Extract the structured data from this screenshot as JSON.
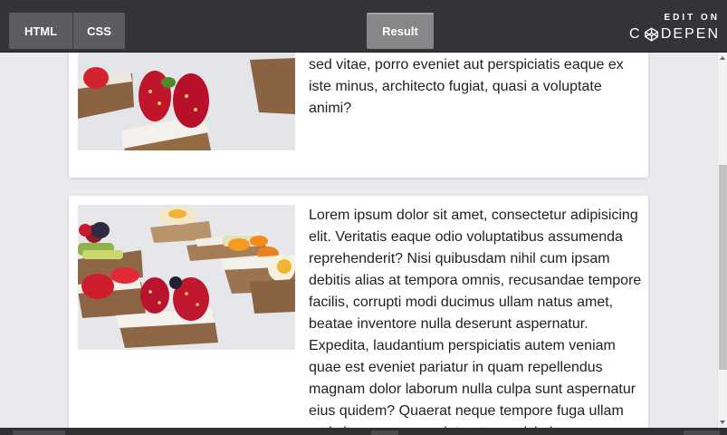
{
  "toolbar": {
    "tabs": [
      "HTML",
      "CSS"
    ],
    "result_label": "Result",
    "edit_on": "EDIT ON",
    "brand": "DEPEN"
  },
  "cards": [
    {
      "text": "quae est eveniet pariatur in quam repellendus magnam dolor laborum nulla culpa sunt aspernatur eius quidem? Quaerat neque tempore fuga ullam sed vitae, porro eveniet aut perspiciatis eaque ex iste minus, architecto fugiat, quasi a voluptate animi?"
    },
    {
      "text": "Lorem ipsum dolor sit amet, consectetur adipisicing elit. Veritatis eaque odio voluptatibus assumenda reprehenderit? Nisi quibusdam nihil cum ipsam debitis alias at tempora omnis, recusandae tempore facilis, corrupti modi ducimus ullam natus amet, beatae inventore nulla deserunt aspernatur. Expedita, laudantium perspiciatis autem veniam quae est eveniet pariatur in quam repellendus magnam dolor laborum nulla culpa sunt aspernatur eius quidem? Quaerat neque tempore fuga ullam sed vitae, porro eveniet aut perspiciatis"
    }
  ],
  "colors": {
    "topbar": "#333438",
    "tab": "#5a5c61",
    "result_tab": "#868789",
    "page_bg": "#e9eaee"
  }
}
